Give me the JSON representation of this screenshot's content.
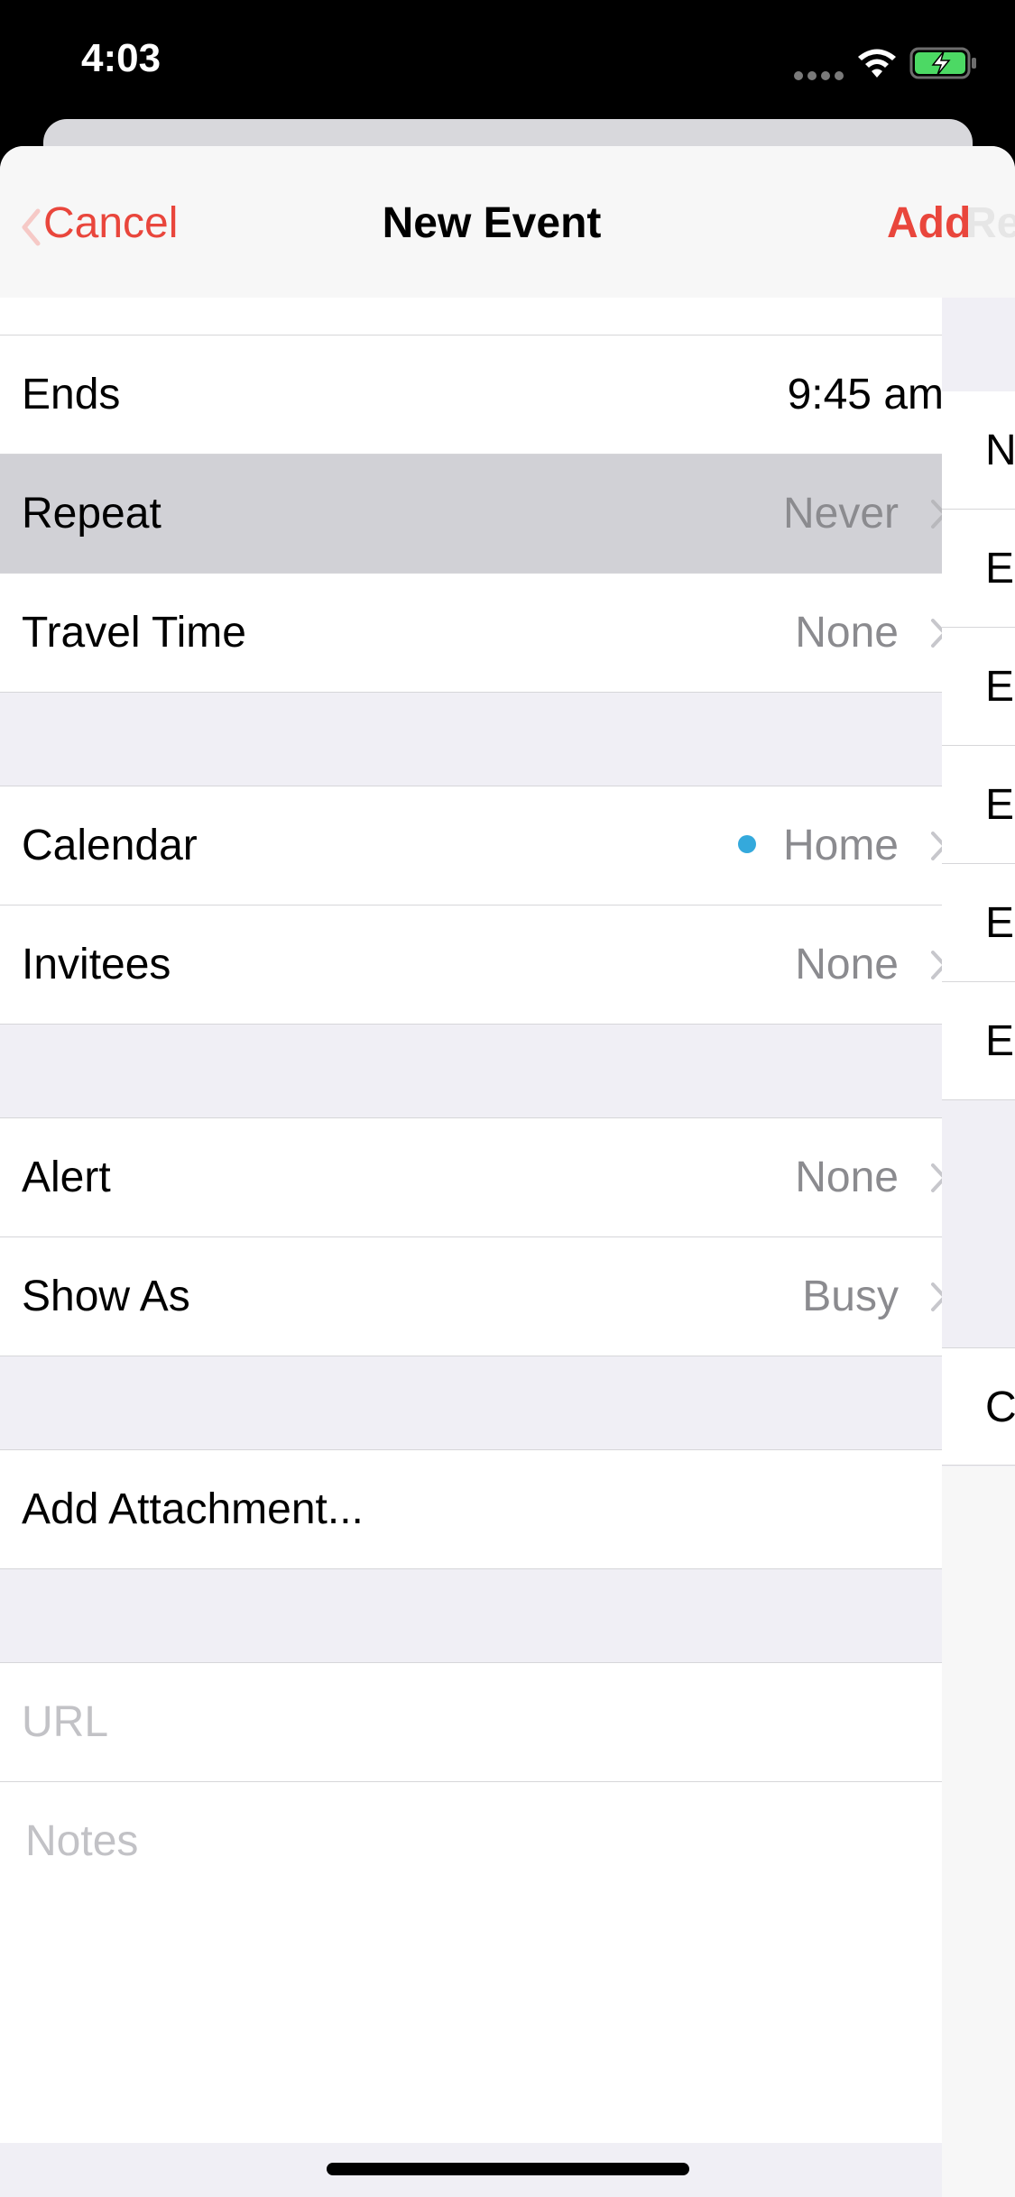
{
  "status_bar": {
    "time": "4:03"
  },
  "nav": {
    "cancel_label": "Cancel",
    "title": "New Event",
    "add_label": "Add",
    "ghost_text": "Re"
  },
  "rows": {
    "ends_label": "Ends",
    "ends_value": "9:45 am",
    "repeat_label": "Repeat",
    "repeat_value": "Never",
    "travel_label": "Travel Time",
    "travel_value": "None",
    "calendar_label": "Calendar",
    "calendar_value": "Home",
    "calendar_color": "#34a9dc",
    "invitees_label": "Invitees",
    "invitees_value": "None",
    "alert_label": "Alert",
    "alert_value": "None",
    "showas_label": "Show As",
    "showas_value": "Busy",
    "attachment_label": "Add Attachment...",
    "url_placeholder": "URL",
    "notes_placeholder": "Notes"
  },
  "right_panel": {
    "rows": [
      "N",
      "E",
      "E",
      "E",
      "E",
      "E"
    ],
    "bottom": "C"
  },
  "colors": {
    "accent": "#e9463c",
    "highlight": "#d1d1d6"
  }
}
